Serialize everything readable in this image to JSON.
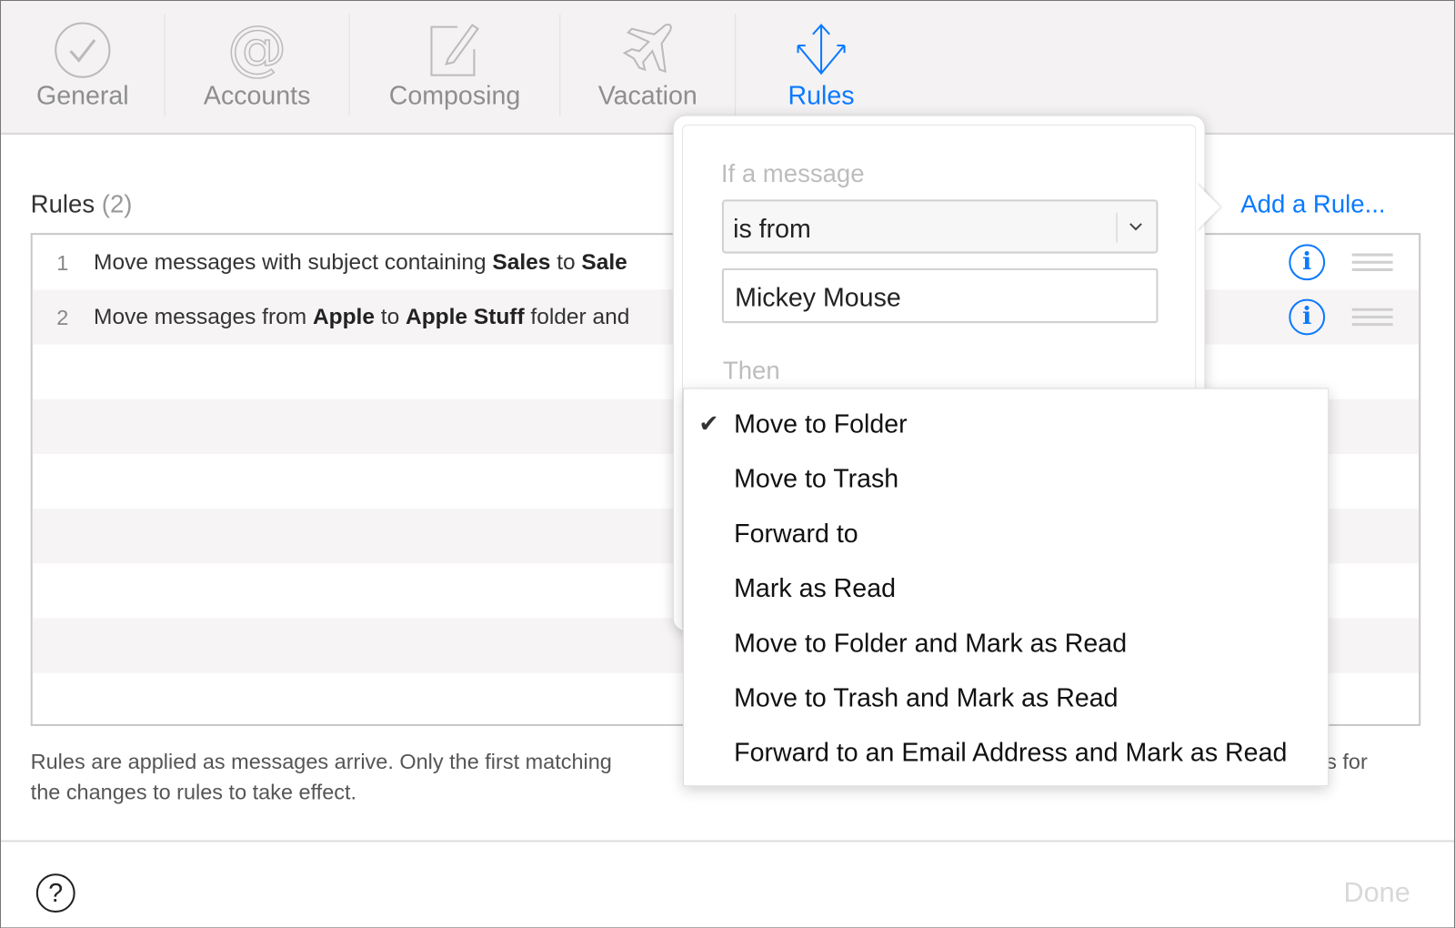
{
  "toolbar": {
    "tabs": [
      {
        "label": "General",
        "icon": "checkmark-circle-icon"
      },
      {
        "label": "Accounts",
        "icon": "at-sign-icon"
      },
      {
        "label": "Composing",
        "icon": "compose-icon"
      },
      {
        "label": "Vacation",
        "icon": "airplane-icon"
      },
      {
        "label": "Rules",
        "icon": "rules-arrows-icon",
        "active": true
      }
    ]
  },
  "rules": {
    "title": "Rules",
    "count": "(2)",
    "add_label": "Add a Rule...",
    "rows": [
      {
        "num": "1",
        "parts": [
          "Move messages with subject containing ",
          "Sales",
          " to ",
          "Sale"
        ]
      },
      {
        "num": "2",
        "parts": [
          "Move messages from ",
          "Apple",
          " to ",
          "Apple Stuff",
          " folder and"
        ]
      }
    ],
    "footer_line1_start": "Rules are applied as messages arrive. Only the first matching",
    "footer_line1_end": "s for",
    "footer_line2": "the changes to rules to take effect."
  },
  "popover": {
    "if_label": "If a message",
    "condition": "is from",
    "value": "Mickey Mouse",
    "then_label": "Then"
  },
  "menu": {
    "selected": "Move to Folder",
    "items": [
      "Move to Folder",
      "Move to Trash",
      "Forward to",
      "Mark as Read",
      "Move to Folder and Mark as Read",
      "Move to Trash and Mark as Read",
      "Forward to an Email Address and Mark as Read"
    ]
  },
  "bottom": {
    "help": "?",
    "done_label": "Done"
  },
  "colors": {
    "accent": "#0a7aff",
    "toolbar_bg": "#f4f2f3",
    "row_alt": "#f6f4f5",
    "disabled": "#d8d8d8"
  }
}
